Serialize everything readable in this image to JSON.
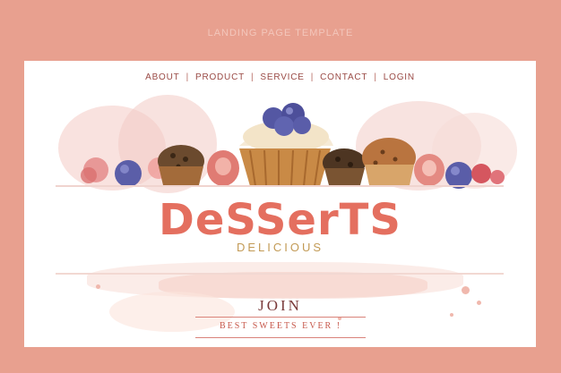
{
  "page": {
    "top_label": "LANDING PAGE TEMPLATE"
  },
  "nav": {
    "items": [
      {
        "label": "ABOUT"
      },
      {
        "label": "PRODUCT"
      },
      {
        "label": "SERVICE"
      },
      {
        "label": "CONTACT"
      },
      {
        "label": "LOGIN"
      }
    ],
    "separator": "|"
  },
  "hero": {
    "title": "DeSSerTS",
    "subtitle": "DELICIOUS",
    "illustration": "watercolor-cupcakes-berries"
  },
  "cta": {
    "join_label": "JOIN",
    "tagline": "BEST SWEETS EVER !"
  },
  "colors": {
    "background": "#e8a08f",
    "card": "#ffffff",
    "title": "#e46f5f",
    "subtitle": "#c29a55",
    "nav_text": "#9a4a45"
  }
}
